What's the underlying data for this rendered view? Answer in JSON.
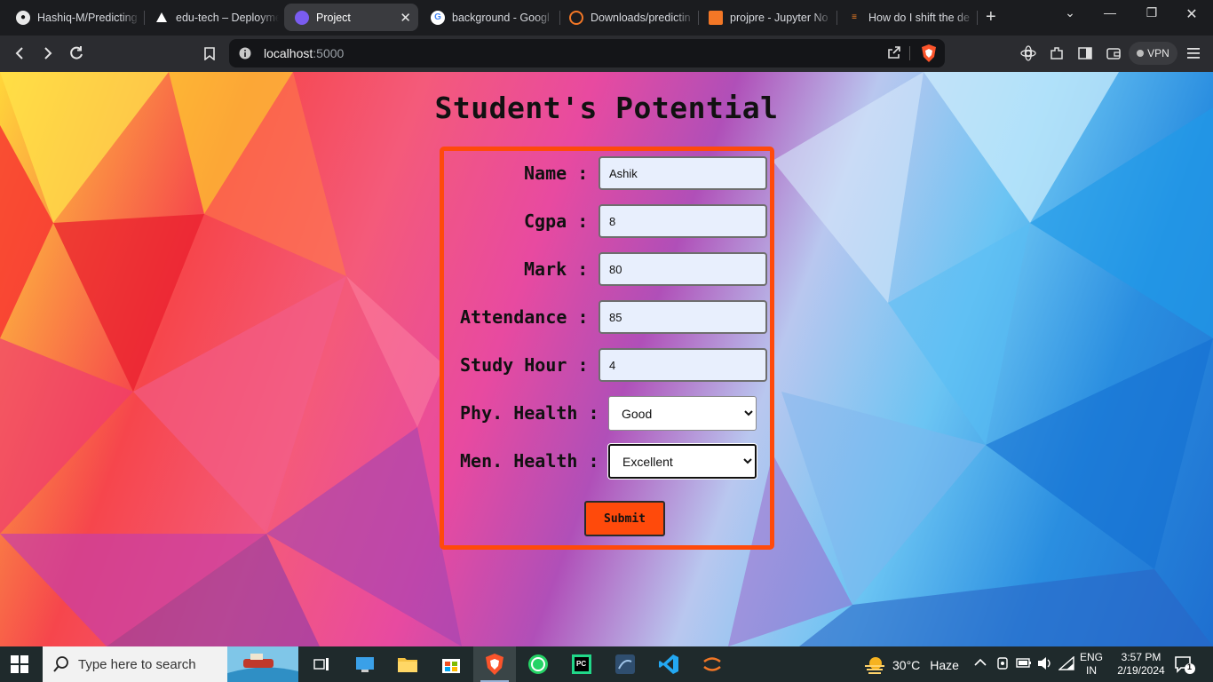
{
  "browser": {
    "tabs": [
      {
        "title": "Hashiq-M/Predicting",
        "favicon": "github-icon"
      },
      {
        "title": "edu-tech – Deployme",
        "favicon": "vercel-icon"
      },
      {
        "title": "Project",
        "favicon": "project-icon",
        "active": true
      },
      {
        "title": "background - Googl",
        "favicon": "google-icon"
      },
      {
        "title": "Downloads/predictin",
        "favicon": "jupyter-icon"
      },
      {
        "title": "projpre - Jupyter No",
        "favicon": "notebook-icon"
      },
      {
        "title": "How do I shift the de",
        "favicon": "stackoverflow-icon"
      }
    ],
    "url": {
      "host": "localhost",
      "port": ":5000"
    },
    "vpn_label": "VPN"
  },
  "page": {
    "title": "Student's Potential",
    "form": {
      "fields": [
        {
          "label": "Name :",
          "value": "Ashik"
        },
        {
          "label": "Cgpa :",
          "value": "8"
        },
        {
          "label": "Mark :",
          "value": "80"
        },
        {
          "label": "Attendance :",
          "value": "85"
        },
        {
          "label": "Study Hour :",
          "value": "4"
        }
      ],
      "selects": [
        {
          "label": "Phy. Health :",
          "value": "Good"
        },
        {
          "label": "Men. Health :",
          "value": "Excellent"
        }
      ],
      "submit_label": "Submit"
    }
  },
  "taskbar": {
    "search_placeholder": "Type here to search",
    "weather": {
      "temp": "30°C",
      "condition": "Haze"
    },
    "lang": {
      "line1": "ENG",
      "line2": "IN"
    },
    "time": "3:57 PM",
    "date": "2/19/2024",
    "notification_count": "1"
  },
  "colors": {
    "accent": "#ff4a0b",
    "input_bg": "#e8effd",
    "browser_chrome": "#2b2c30"
  }
}
